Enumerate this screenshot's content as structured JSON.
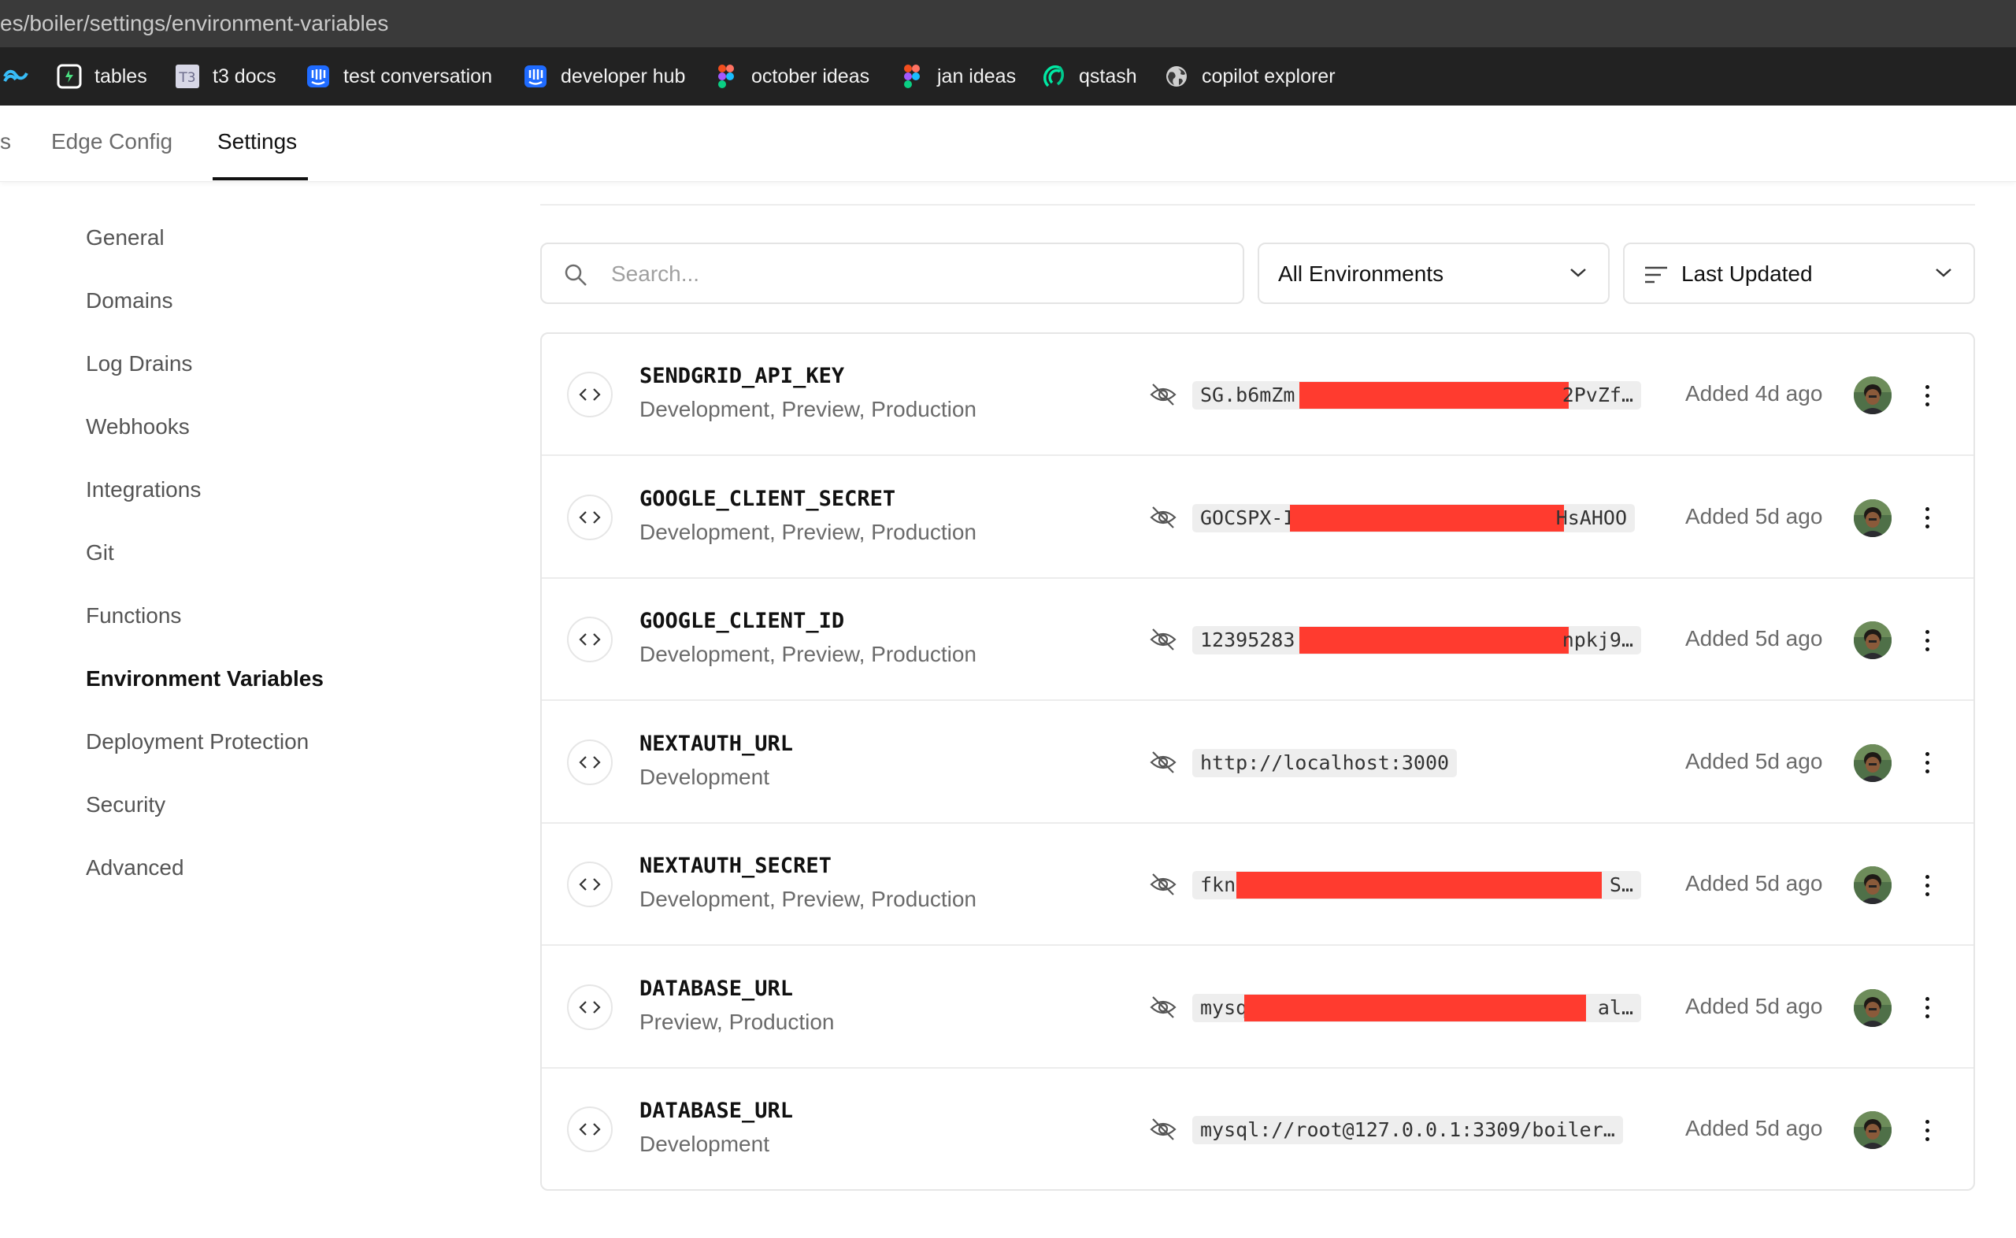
{
  "browser": {
    "url": "es/boiler/settings/environment-variables",
    "bookmarks": [
      {
        "label": "",
        "icon": "tailwind-icon"
      },
      {
        "label": "tables",
        "icon": "tables-icon"
      },
      {
        "label": "t3 docs",
        "icon": "t3-icon"
      },
      {
        "label": "test conversation",
        "icon": "intercom-icon"
      },
      {
        "label": "developer hub",
        "icon": "intercom-icon"
      },
      {
        "label": "october ideas",
        "icon": "figma-icon"
      },
      {
        "label": "jan ideas",
        "icon": "figma-icon"
      },
      {
        "label": "qstash",
        "icon": "upstash-icon"
      },
      {
        "label": "copilot explorer",
        "icon": "globe-icon"
      }
    ]
  },
  "topnav": {
    "partial_tab": "s",
    "edge_config": "Edge Config",
    "settings": "Settings"
  },
  "sidebar": {
    "items": [
      "General",
      "Domains",
      "Log Drains",
      "Webhooks",
      "Integrations",
      "Git",
      "Functions",
      "Environment Variables",
      "Deployment Protection",
      "Security",
      "Advanced"
    ],
    "active": "Environment Variables"
  },
  "controls": {
    "search_placeholder": "Search...",
    "environment_filter": "All Environments",
    "sort": "Last Updated"
  },
  "env_vars": [
    {
      "name": "SENDGRID_API_KEY",
      "environments": "Development, Preview, Production",
      "value_prefix": "SG.b6mZm",
      "value_suffix": "2PvZf…",
      "redacted": true,
      "added": "Added 4d ago"
    },
    {
      "name": "GOOGLE_CLIENT_SECRET",
      "environments": "Development, Preview, Production",
      "value_prefix": "GOCSPX-I",
      "value_suffix": "HsAHOO",
      "redacted": true,
      "added": "Added 5d ago"
    },
    {
      "name": "GOOGLE_CLIENT_ID",
      "environments": "Development, Preview, Production",
      "value_prefix": "12395283",
      "value_suffix": "npkj9…",
      "redacted": true,
      "added": "Added 5d ago"
    },
    {
      "name": "NEXTAUTH_URL",
      "environments": "Development",
      "value_prefix": "http://localhost:3000",
      "value_suffix": "",
      "redacted": false,
      "added": "Added 5d ago"
    },
    {
      "name": "NEXTAUTH_SECRET",
      "environments": "Development, Preview, Production",
      "value_prefix": "fkn",
      "value_suffix": "S…",
      "redacted": true,
      "added": "Added 5d ago"
    },
    {
      "name": "DATABASE_URL",
      "environments": "Preview, Production",
      "value_prefix": "mysq",
      "value_suffix": "al…",
      "redacted": true,
      "added": "Added 5d ago"
    },
    {
      "name": "DATABASE_URL",
      "environments": "Development",
      "value_prefix": "mysql://root@127.0.0.1:3309/boiler…",
      "value_suffix": "",
      "redacted": false,
      "added": "Added 5d ago"
    }
  ],
  "colors": {
    "redaction": "#ff3b2f",
    "bookmark_bar": "#222222",
    "url_bar": "#3a3a3a"
  }
}
